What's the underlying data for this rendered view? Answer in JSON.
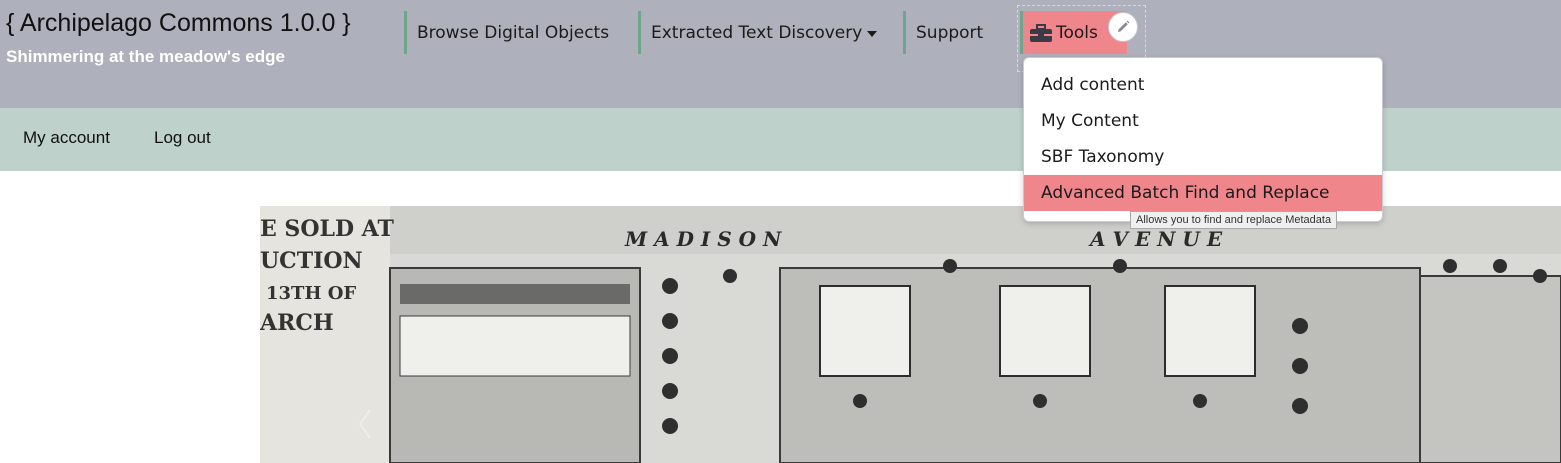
{
  "site": {
    "title": "{ Archipelago Commons 1.0.0 }",
    "slogan": "Shimmering at the meadow's edge"
  },
  "main_nav": {
    "items": [
      {
        "label": "Browse Digital Objects"
      },
      {
        "label": "Extracted Text Discovery",
        "has_dropdown": true
      },
      {
        "label": "Support"
      },
      {
        "label": "Tools",
        "icon": "toolbox-icon",
        "active": true
      }
    ],
    "edit_icon": "pencil-icon"
  },
  "tools_menu": {
    "items": [
      {
        "label": "Add content"
      },
      {
        "label": "My Content"
      },
      {
        "label": "SBF Taxonomy"
      },
      {
        "label": "Advanced Batch Find and Replace",
        "hovered": true
      }
    ],
    "tooltip": "Allows you to find and replace Metadata"
  },
  "account_nav": {
    "my_account": "My account",
    "log_out": "Log out"
  },
  "hero": {
    "image_text": {
      "street": "M A D I S O N",
      "avenue": "A V E N U E",
      "sale_line1": "E SOLD AT",
      "sale_line2": "UCTION",
      "sale_line3": "13TH OF",
      "sale_line4": "ARCH"
    },
    "prev_icon": "chevron-left-icon"
  },
  "colors": {
    "header_bg": "#aeb0bb",
    "secondary_bg": "#bed1cb",
    "accent": "#ef868c",
    "separator": "#6fa58d"
  }
}
